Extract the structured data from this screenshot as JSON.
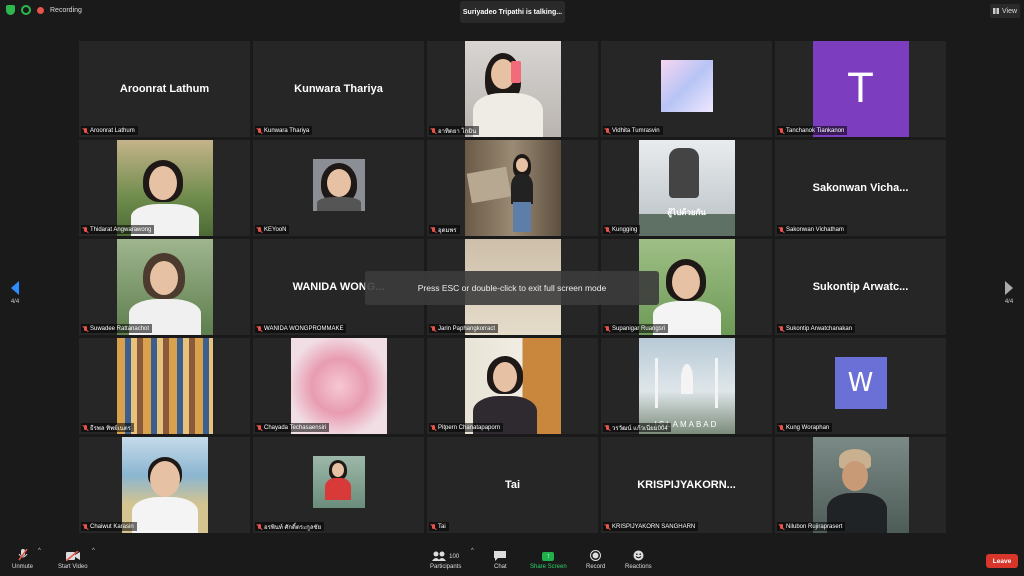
{
  "topbar": {
    "recording_label": "Recording",
    "talking": "Suriyadeo Tripathi is talking...",
    "view_label": "View"
  },
  "overlay": {
    "esc_message": "Press ESC or double-click to exit full screen mode"
  },
  "pager": {
    "left": "4/4",
    "right": "4/4"
  },
  "tiles": [
    {
      "label": "Aroonrat Lathum",
      "display": "Aroonrat Lathum"
    },
    {
      "label": "Kunwara Thariya",
      "display": "Kunwara Thariya"
    },
    {
      "label": "อาทิตยา โกมิน",
      "display": ""
    },
    {
      "label": "Vidhita Tumrasvin",
      "display": ""
    },
    {
      "label": "Tanchanok Tiankanon",
      "display": "",
      "letter": "T"
    },
    {
      "label": "Thidarat Angwarawong",
      "display": ""
    },
    {
      "label": "KEYooN",
      "display": ""
    },
    {
      "label": "อุดมพร",
      "display": ""
    },
    {
      "label": "Kungging",
      "display": "",
      "caption": "สู้ไปด้วยกัน"
    },
    {
      "label": "Sakonwan Vichatham",
      "display": "Sakonwan  Vicha..."
    },
    {
      "label": "Suwadee Rattanachot",
      "display": ""
    },
    {
      "label": "WANIDA WONGPROMMAKE",
      "display": "WANIDA  WONG..."
    },
    {
      "label": "Jarin Paphangkorract",
      "display": ""
    },
    {
      "label": "Supanigar Ruangsri",
      "display": ""
    },
    {
      "label": "Sukontip Arwatchanakan",
      "display": "Sukontip  Arwatc..."
    },
    {
      "label": "ธีรพล ทิพย์เนตร",
      "display": ""
    },
    {
      "label": "Chayada Techasaensiri",
      "display": ""
    },
    {
      "label": "Pitpern Chanatapaporn",
      "display": ""
    },
    {
      "label": "วรวัฒน์ แก้วเนียม004",
      "display": "",
      "caption": "ISLAMABAD"
    },
    {
      "label": "Kung Woraphan",
      "display": "",
      "letter": "W"
    },
    {
      "label": "Chaiwut Karasin",
      "display": ""
    },
    {
      "label": "อรพินท์ ศักดิ์ตระกูลชัย",
      "display": ""
    },
    {
      "label": "Tai",
      "display": "Tai"
    },
    {
      "label": "KRISPIJYAKORN SANGHARN",
      "display": "KRISPIJYAKORN..."
    },
    {
      "label": "Nilubon Rujiraprasert",
      "display": ""
    }
  ],
  "toolbar": {
    "unmute": "Unmute",
    "start_video": "Start Video",
    "participants": "Participants",
    "participant_count": "100",
    "chat": "Chat",
    "share_screen": "Share Screen",
    "record": "Record",
    "reactions": "Reactions",
    "leave": "Leave"
  },
  "colors": {
    "accent_blue": "#2d8cff",
    "leave_red": "#d9362b",
    "share_green": "#20b04c",
    "avatar_purple": "#7c3dbf",
    "avatar_blue": "#6a70d6"
  }
}
